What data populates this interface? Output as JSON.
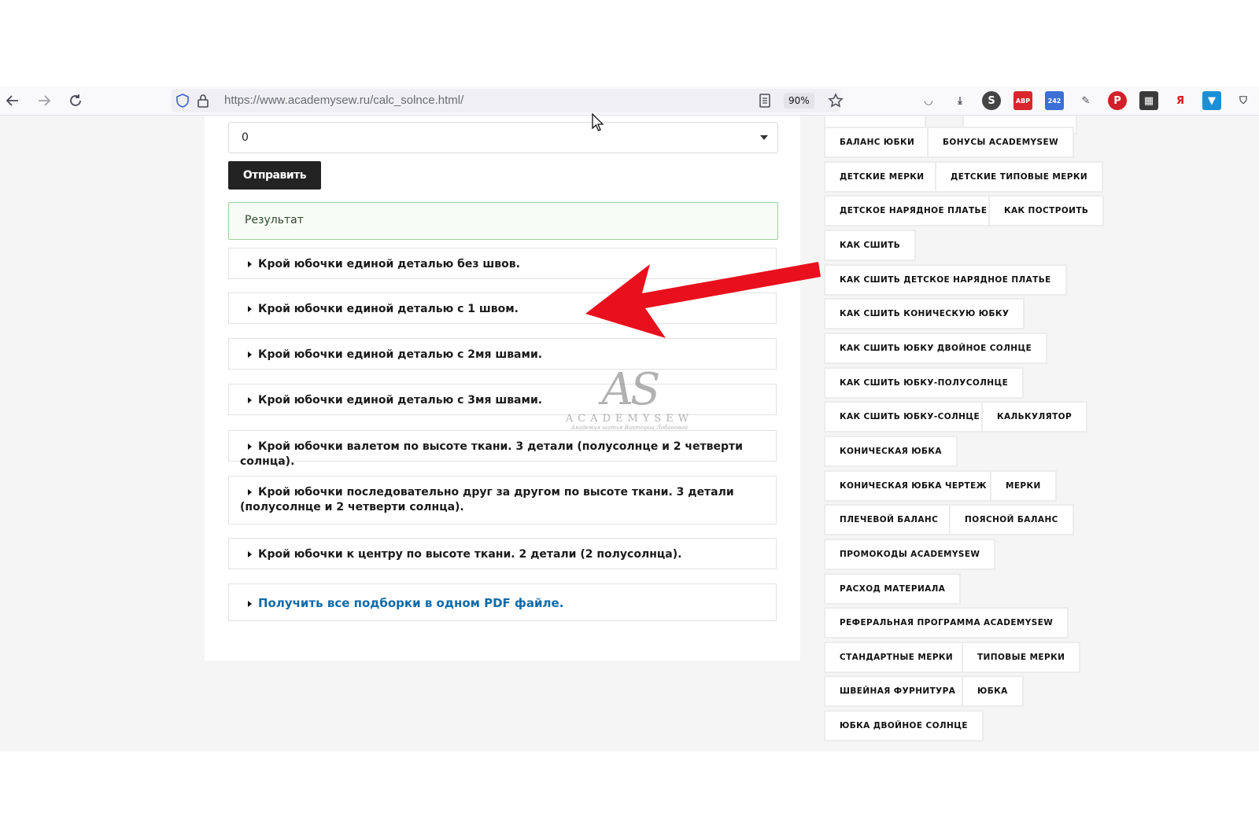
{
  "browser": {
    "url": "https://www.academysew.ru/calc_solnce.html/",
    "zoom": "90%",
    "nav_icons": [
      "back-arrow-icon",
      "forward-arrow-icon",
      "reload-icon"
    ],
    "extensions": [
      {
        "name": "pocket-icon",
        "glyph": "◡"
      },
      {
        "name": "download-icon",
        "glyph": "⤓"
      },
      {
        "name": "s-extension-icon",
        "glyph": "S"
      },
      {
        "name": "adblock-icon",
        "glyph": "ABP"
      },
      {
        "name": "calendar-extension-icon",
        "glyph": "242"
      },
      {
        "name": "translate-extension-icon",
        "glyph": "✎"
      },
      {
        "name": "pinterest-icon",
        "glyph": "P"
      },
      {
        "name": "color-extension-icon",
        "glyph": "▦"
      },
      {
        "name": "yandex-icon",
        "glyph": "Я"
      },
      {
        "name": "vpn-shield-icon",
        "glyph": "▼"
      },
      {
        "name": "shield-extension-icon",
        "glyph": "⛉"
      }
    ]
  },
  "form": {
    "select_value": "0",
    "submit_label": "Отправить",
    "result_label": "Результат"
  },
  "accordion": [
    "Крой юбочки единой деталью без швов.",
    "Крой юбочки единой деталью с 1 швом.",
    "Крой юбочки единой деталью с 2мя швами.",
    "Крой юбочки единой деталью с 3мя швами.",
    "Крой юбочки валетом по высоте ткани. 3 детали (полусолнце и 2 четверти солнца).",
    "Крой юбочки последовательно друг за другом по высоте ткани. 3 детали (полусолнце и 2 четверти солнца).",
    "Крой юбочки к центру по высоте ткани. 2 детали (2 полусолнца).",
    "Получить все подборки в одном PDF файле."
  ],
  "watermark": {
    "logo": "AS",
    "name": "ACADEMYSEW",
    "tagline": "Академия шитья Виктории Лобановой"
  },
  "tags": [
    "БАЛАНС ЮБКИ",
    "БОНУСЫ ACADEMYSEW",
    "ДЕТСКИЕ МЕРКИ",
    "ДЕТСКИЕ ТИПОВЫЕ МЕРКИ",
    "ДЕТСКОЕ НАРЯДНОЕ ПЛАТЬЕ",
    "КАК ПОСТРОИТЬ",
    "КАК СШИТЬ",
    "КАК СШИТЬ ДЕТСКОЕ НАРЯДНОЕ ПЛАТЬЕ",
    "КАК СШИТЬ КОНИЧЕСКУЮ ЮБКУ",
    "КАК СШИТЬ ЮБКУ ДВОЙНОЕ СОЛНЦЕ",
    "КАК СШИТЬ ЮБКУ-ПОЛУСОЛНЦЕ",
    "КАК СШИТЬ ЮБКУ-СОЛНЦЕ",
    "КАЛЬКУЛЯТОР",
    "КОНИЧЕСКАЯ ЮБКА",
    "КОНИЧЕСКАЯ ЮБКА ЧЕРТЕЖ",
    "МЕРКИ",
    "ПЛЕЧЕВОЙ БАЛАНС",
    "ПОЯСНОЙ БАЛАНС",
    "ПРОМОКОДЫ ACADEMYSEW",
    "РАСХОД МАТЕРИАЛА",
    "РЕФЕРАЛЬНАЯ ПРОГРАММА ACADEMYSEW",
    "СТАНДАРТНЫЕ МЕРКИ",
    "ТИПОВЫЕ МЕРКИ",
    "ШВЕЙНАЯ ФУРНИТУРА",
    "ЮБКА",
    "ЮБКА ДВОЙНОЕ СОЛНЦЕ"
  ],
  "colors": {
    "arrow": "#e8101c",
    "link": "#0f6aa8",
    "submit_bg": "#232323",
    "result_border": "#9fcf9f"
  }
}
